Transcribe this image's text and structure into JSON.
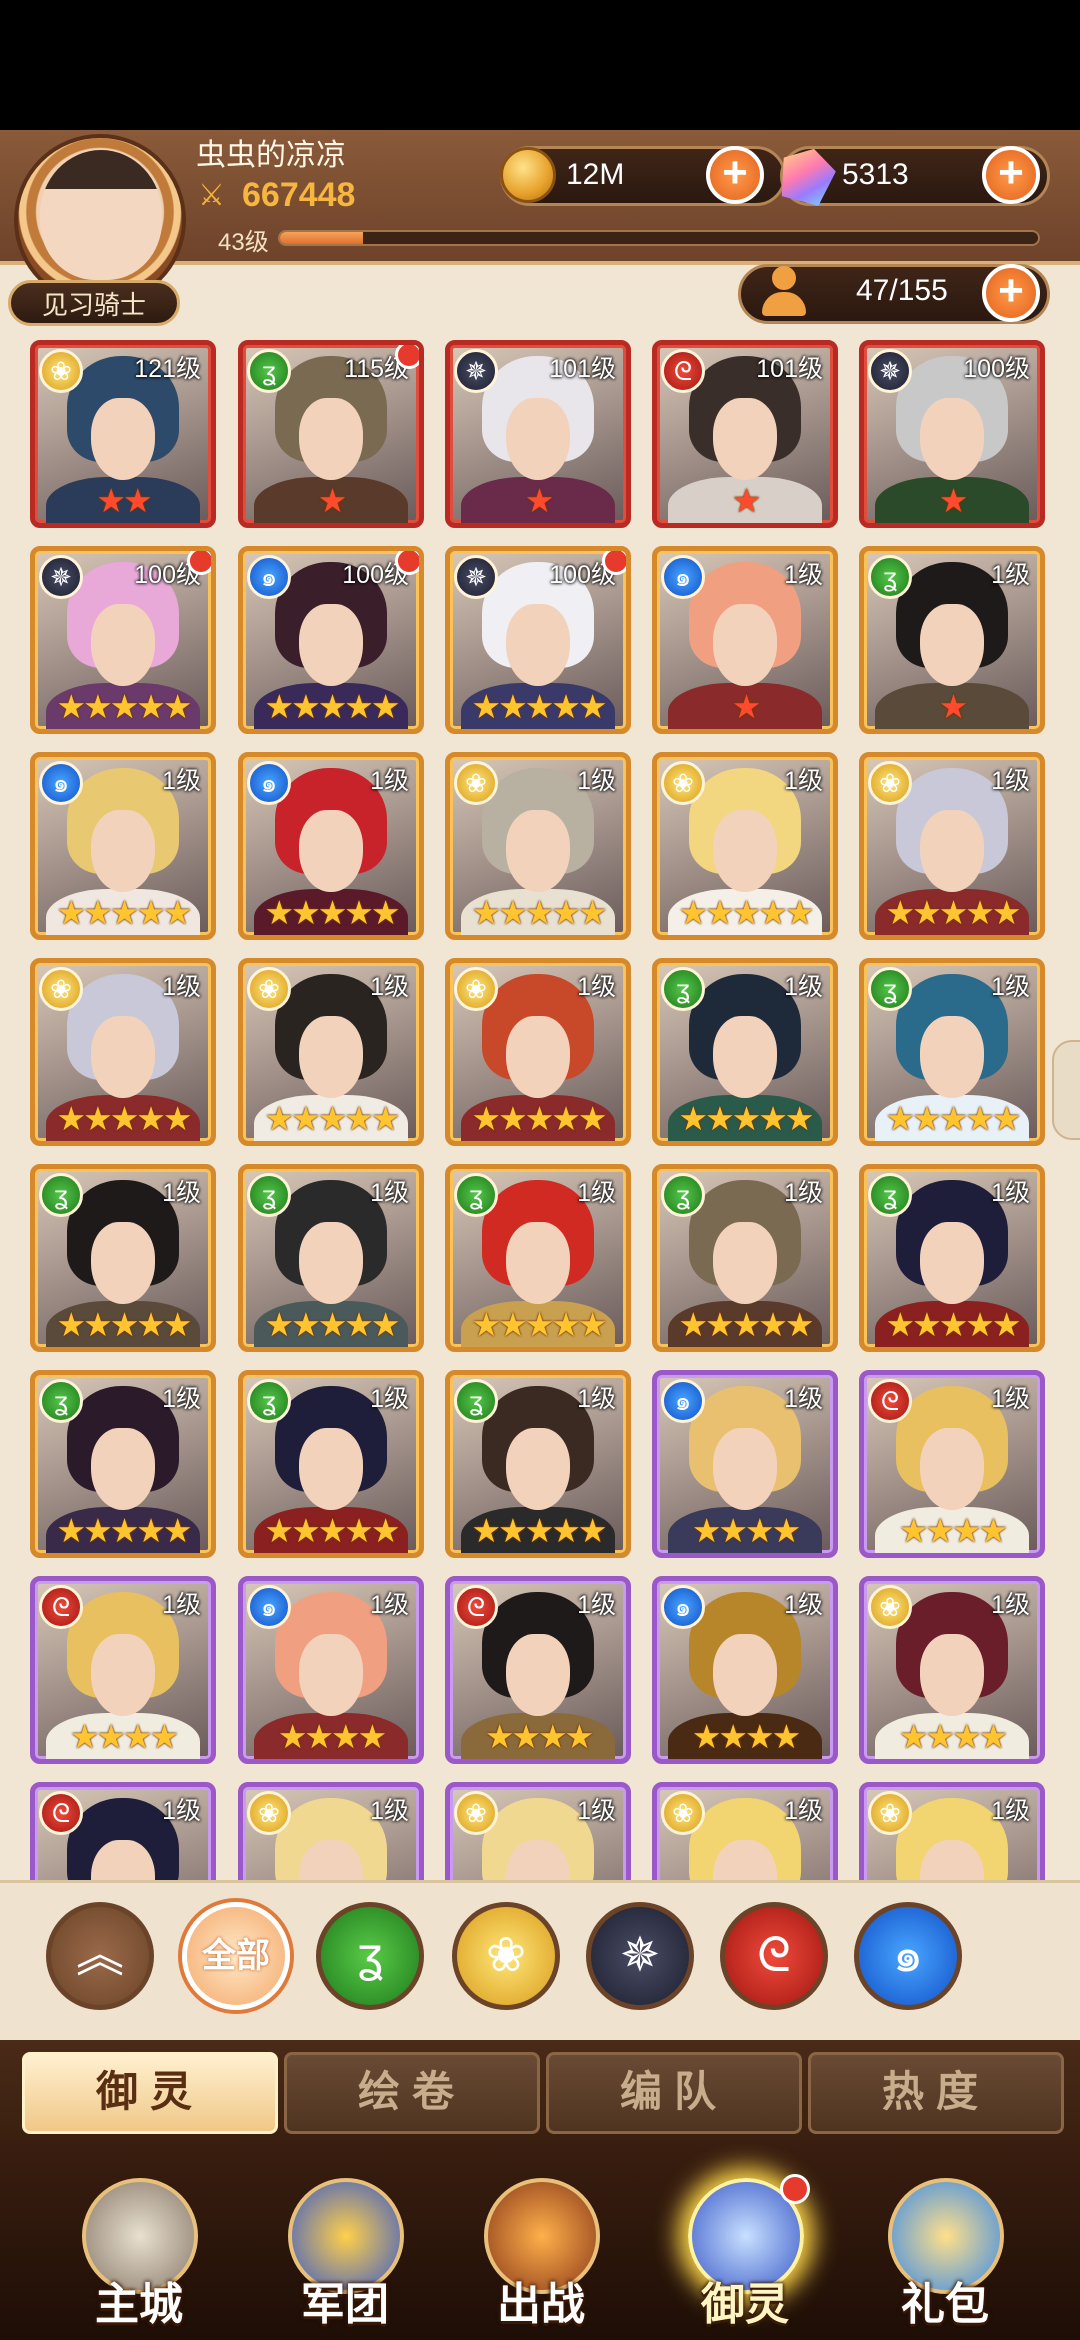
{
  "header": {
    "player_name": "虫虫的凉凉",
    "power": "667448",
    "level": "43级",
    "level_progress": 0.11,
    "rank": "见习骑士",
    "coins": "12M",
    "gems": "5313",
    "members": "47/155"
  },
  "heroes": [
    {
      "level": "121级",
      "element": "gold",
      "frame": "red",
      "stars": 2,
      "star_color": "red",
      "dot": false,
      "hair": "#2d4a6a",
      "outfit": "#2a3c5a"
    },
    {
      "level": "115级",
      "element": "green",
      "frame": "red",
      "stars": 1,
      "star_color": "red",
      "dot": true,
      "hair": "#7a6a52",
      "outfit": "#5a3a2a"
    },
    {
      "level": "101级",
      "element": "dark",
      "frame": "red",
      "stars": 1,
      "star_color": "red",
      "dot": false,
      "hair": "#e8e6ea",
      "outfit": "#6a2a4a"
    },
    {
      "level": "101级",
      "element": "red",
      "frame": "red",
      "stars": 1,
      "star_color": "red",
      "dot": false,
      "hair": "#3a2e2a",
      "outfit": "#d8d0c8"
    },
    {
      "level": "100级",
      "element": "dark",
      "frame": "red",
      "stars": 1,
      "star_color": "red",
      "dot": false,
      "hair": "#c8c8c8",
      "outfit": "#2a4a2a"
    },
    {
      "level": "100级",
      "element": "dark",
      "frame": "orange",
      "stars": 5,
      "star_color": "gold",
      "dot": true,
      "hair": "#e8a8d8",
      "outfit": "#6a3a6a"
    },
    {
      "level": "100级",
      "element": "blue",
      "frame": "orange",
      "stars": 5,
      "star_color": "gold",
      "dot": true,
      "hair": "#3a1e2a",
      "outfit": "#3a2a5a"
    },
    {
      "level": "100级",
      "element": "dark",
      "frame": "orange",
      "stars": 5,
      "star_color": "gold",
      "dot": true,
      "hair": "#f0f0f4",
      "outfit": "#3a3a6a"
    },
    {
      "level": "1级",
      "element": "blue",
      "frame": "orange",
      "stars": 1,
      "star_color": "red",
      "dot": false,
      "hair": "#f0a080",
      "outfit": "#8a2a2a"
    },
    {
      "level": "1级",
      "element": "green",
      "frame": "orange",
      "stars": 1,
      "star_color": "red",
      "dot": false,
      "hair": "#1e1a1a",
      "outfit": "#5a4a3a"
    },
    {
      "level": "1级",
      "element": "blue",
      "frame": "orange",
      "stars": 5,
      "star_color": "gold",
      "dot": false,
      "hair": "#e8c870",
      "outfit": "#f0e8e0"
    },
    {
      "level": "1级",
      "element": "blue",
      "frame": "orange",
      "stars": 5,
      "star_color": "gold",
      "dot": false,
      "hair": "#c8222a",
      "outfit": "#5a1a2a"
    },
    {
      "level": "1级",
      "element": "gold",
      "frame": "orange",
      "stars": 5,
      "star_color": "gold",
      "dot": false,
      "hair": "#b8b0a0",
      "outfit": "#e8e0d0"
    },
    {
      "level": "1级",
      "element": "gold",
      "frame": "orange",
      "stars": 5,
      "star_color": "gold",
      "dot": false,
      "hair": "#f2d680",
      "outfit": "#f4f0e8"
    },
    {
      "level": "1级",
      "element": "gold",
      "frame": "orange",
      "stars": 5,
      "star_color": "gold",
      "dot": false,
      "hair": "#c8c8d8",
      "outfit": "#8a2a2a"
    },
    {
      "level": "1级",
      "element": "gold",
      "frame": "orange",
      "stars": 5,
      "star_color": "gold",
      "dot": false,
      "hair": "#c8c8d8",
      "outfit": "#8a2a2a"
    },
    {
      "level": "1级",
      "element": "gold",
      "frame": "orange",
      "stars": 5,
      "star_color": "gold",
      "dot": false,
      "hair": "#2a2420",
      "outfit": "#f0ece4"
    },
    {
      "level": "1级",
      "element": "gold",
      "frame": "orange",
      "stars": 5,
      "star_color": "gold",
      "dot": false,
      "hair": "#c8482a",
      "outfit": "#8a2a2a"
    },
    {
      "level": "1级",
      "element": "green",
      "frame": "orange",
      "stars": 5,
      "star_color": "gold",
      "dot": false,
      "hair": "#1e2a3a",
      "outfit": "#2a5a4a"
    },
    {
      "level": "1级",
      "element": "green",
      "frame": "orange",
      "stars": 5,
      "star_color": "gold",
      "dot": false,
      "hair": "#2a6a8a",
      "outfit": "#e8f0f8"
    },
    {
      "level": "1级",
      "element": "green",
      "frame": "orange",
      "stars": 5,
      "star_color": "gold",
      "dot": false,
      "hair": "#1e1a1a",
      "outfit": "#5a4a3a"
    },
    {
      "level": "1级",
      "element": "green",
      "frame": "orange",
      "stars": 5,
      "star_color": "gold",
      "dot": false,
      "hair": "#2a2a2a",
      "outfit": "#4a5a5a"
    },
    {
      "level": "1级",
      "element": "green",
      "frame": "orange",
      "stars": 5,
      "star_color": "gold",
      "dot": false,
      "hair": "#d02a22",
      "outfit": "#c8a050"
    },
    {
      "level": "1级",
      "element": "green",
      "frame": "orange",
      "stars": 5,
      "star_color": "gold",
      "dot": false,
      "hair": "#7a6a52",
      "outfit": "#5a3a2a"
    },
    {
      "level": "1级",
      "element": "green",
      "frame": "orange",
      "stars": 5,
      "star_color": "gold",
      "dot": false,
      "hair": "#1e1e3a",
      "outfit": "#8a2020"
    },
    {
      "level": "1级",
      "element": "green",
      "frame": "orange",
      "stars": 5,
      "star_color": "gold",
      "dot": false,
      "hair": "#2a1a2a",
      "outfit": "#3a2a4a"
    },
    {
      "level": "1级",
      "element": "green",
      "frame": "orange",
      "stars": 5,
      "star_color": "gold",
      "dot": false,
      "hair": "#1e1e3a",
      "outfit": "#8a2020"
    },
    {
      "level": "1级",
      "element": "green",
      "frame": "orange",
      "stars": 5,
      "star_color": "gold",
      "dot": false,
      "hair": "#3a2a22",
      "outfit": "#2a2a2a"
    },
    {
      "level": "1级",
      "element": "blue",
      "frame": "purple",
      "stars": 4,
      "star_color": "gold",
      "dot": false,
      "hair": "#e8c070",
      "outfit": "#3a3a5a"
    },
    {
      "level": "1级",
      "element": "red",
      "frame": "purple",
      "stars": 4,
      "star_color": "gold",
      "dot": false,
      "hair": "#e8c060",
      "outfit": "#f0ece0"
    },
    {
      "level": "1级",
      "element": "red",
      "frame": "purple",
      "stars": 4,
      "star_color": "gold",
      "dot": false,
      "hair": "#e8c060",
      "outfit": "#f0ece0"
    },
    {
      "level": "1级",
      "element": "blue",
      "frame": "purple",
      "stars": 4,
      "star_color": "gold",
      "dot": false,
      "hair": "#f0a080",
      "outfit": "#8a2a2a"
    },
    {
      "level": "1级",
      "element": "red",
      "frame": "purple",
      "stars": 4,
      "star_color": "gold",
      "dot": false,
      "hair": "#1e1a1a",
      "outfit": "#8a6a3a"
    },
    {
      "level": "1级",
      "element": "blue",
      "frame": "purple",
      "stars": 4,
      "star_color": "gold",
      "dot": false,
      "hair": "#b8862a",
      "outfit": "#4a2a12"
    },
    {
      "level": "1级",
      "element": "gold",
      "frame": "purple",
      "stars": 4,
      "star_color": "gold",
      "dot": false,
      "hair": "#6a1e2a",
      "outfit": "#f0ece0"
    },
    {
      "level": "1级",
      "element": "red",
      "frame": "purple",
      "stars": 0,
      "star_color": "gold",
      "dot": false,
      "hair": "#1e1e3a",
      "outfit": "#3a3a5a"
    },
    {
      "level": "1级",
      "element": "gold",
      "frame": "purple",
      "stars": 0,
      "star_color": "gold",
      "dot": false,
      "hair": "#f0d890",
      "outfit": "#f0ece0"
    },
    {
      "level": "1级",
      "element": "gold",
      "frame": "purple",
      "stars": 0,
      "star_color": "gold",
      "dot": false,
      "hair": "#f0d890",
      "outfit": "#f0ece0"
    },
    {
      "level": "1级",
      "element": "gold",
      "frame": "purple",
      "stars": 0,
      "star_color": "gold",
      "dot": false,
      "hair": "#f2d470",
      "outfit": "#f0ece0"
    },
    {
      "level": "1级",
      "element": "gold",
      "frame": "purple",
      "stars": 0,
      "star_color": "gold",
      "dot": false,
      "hair": "#f2d470",
      "outfit": "#f0ece0"
    }
  ],
  "element_icons": {
    "gold": "rose-icon",
    "green": "wind-icon",
    "dark": "web-icon",
    "red": "flame-icon",
    "blue": "wave-icon"
  },
  "filters": {
    "all": "全部"
  },
  "tabs": [
    "御灵",
    "绘卷",
    "编队",
    "热度"
  ],
  "nav": [
    "主城",
    "军团",
    "出战",
    "御灵",
    "礼包"
  ],
  "colors": {
    "accent": "#e2621d",
    "frame_orange": "#d6892a",
    "frame_red": "#b92a22",
    "frame_purple": "#9b58c9"
  }
}
